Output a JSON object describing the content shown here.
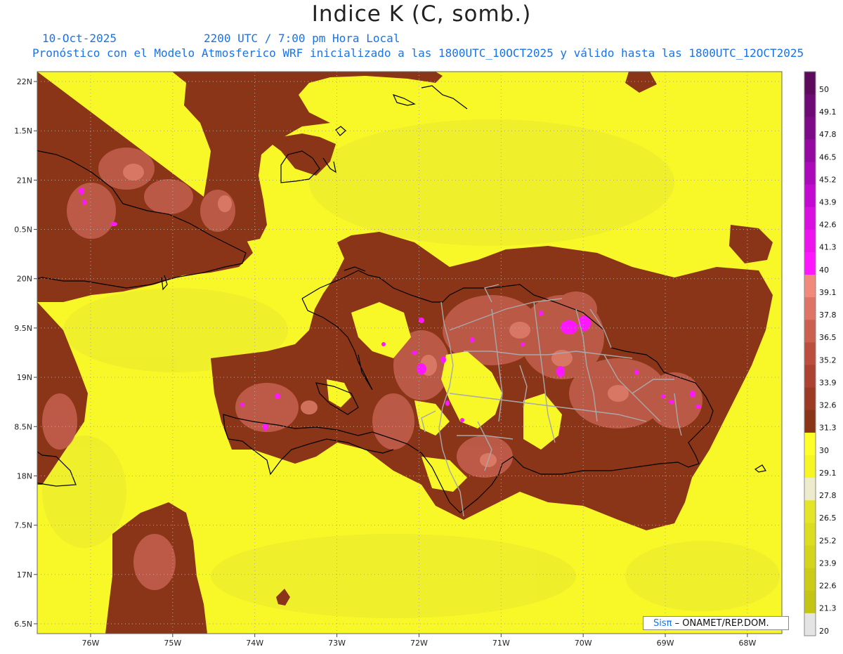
{
  "title": "Indice K (C, somb.)",
  "date_line": "10-Oct-2025",
  "time_line": "2200 UTC / 7:00 pm Hora Local",
  "forecast_line": "Pronóstico con el Modelo Atmosferico WRF inicializado a las 1800UTC_10OCT2025 y válido hasta las  1800UTC_12OCT2025",
  "credit": {
    "brand": "Sisπ",
    "text": "– ONAMET/REP.DOM."
  },
  "map": {
    "lon_range": [
      -76.65,
      -67.58
    ],
    "lat_range": [
      16.4,
      22.1
    ],
    "lon_ticks": [
      {
        "value": -76,
        "label": "76W"
      },
      {
        "value": -75,
        "label": "75W"
      },
      {
        "value": -74,
        "label": "74W"
      },
      {
        "value": -73,
        "label": "73W"
      },
      {
        "value": -72,
        "label": "72W"
      },
      {
        "value": -71,
        "label": "71W"
      },
      {
        "value": -70,
        "label": "70W"
      },
      {
        "value": -69,
        "label": "69W"
      },
      {
        "value": -68,
        "label": "68W"
      }
    ],
    "lat_ticks": [
      {
        "value": 22,
        "label": "22N"
      },
      {
        "value": 21.5,
        "label": "1.5N"
      },
      {
        "value": 21,
        "label": "21N"
      },
      {
        "value": 20.5,
        "label": "0.5N"
      },
      {
        "value": 20,
        "label": "20N"
      },
      {
        "value": 19.5,
        "label": "9.5N"
      },
      {
        "value": 19,
        "label": "19N"
      },
      {
        "value": 18.5,
        "label": "8.5N"
      },
      {
        "value": 18,
        "label": "18N"
      },
      {
        "value": 17.5,
        "label": "7.5N"
      },
      {
        "value": 17,
        "label": "17N"
      },
      {
        "value": 16.5,
        "label": "6.5N"
      }
    ],
    "background_color": "#f8f828",
    "high_color": "#8b3518"
  },
  "colorbar": {
    "levels": [
      {
        "label": "50",
        "color": "#5c0a5c"
      },
      {
        "label": "49.1",
        "color": "#6e0a74"
      },
      {
        "label": "47.8",
        "color": "#7d0a86"
      },
      {
        "label": "46.5",
        "color": "#940aa0"
      },
      {
        "label": "45.2",
        "color": "#aa0ab8"
      },
      {
        "label": "43.9",
        "color": "#c20ad0"
      },
      {
        "label": "42.6",
        "color": "#d810e0"
      },
      {
        "label": "41.3",
        "color": "#ee14ee"
      },
      {
        "label": "40",
        "color": "#ff18ff"
      },
      {
        "label": "39.1",
        "color": "#f08a7c"
      },
      {
        "label": "37.8",
        "color": "#de7466"
      },
      {
        "label": "36.5",
        "color": "#cc6050"
      },
      {
        "label": "35.2",
        "color": "#bc4e3e"
      },
      {
        "label": "33.9",
        "color": "#ac4232"
      },
      {
        "label": "32.6",
        "color": "#9c3a24"
      },
      {
        "label": "31.3",
        "color": "#8b3518"
      },
      {
        "label": "30",
        "color": "#fefe28"
      },
      {
        "label": "29.1",
        "color": "#f6f624"
      },
      {
        "label": "27.8",
        "color": "#ececcc"
      },
      {
        "label": "26.5",
        "color": "#e4e428"
      },
      {
        "label": "25.2",
        "color": "#dcdc20"
      },
      {
        "label": "23.9",
        "color": "#d4d41c"
      },
      {
        "label": "22.6",
        "color": "#cccc18"
      },
      {
        "label": "21.3",
        "color": "#c4c414"
      },
      {
        "label": "20",
        "color": "#e4e4e4"
      }
    ]
  }
}
